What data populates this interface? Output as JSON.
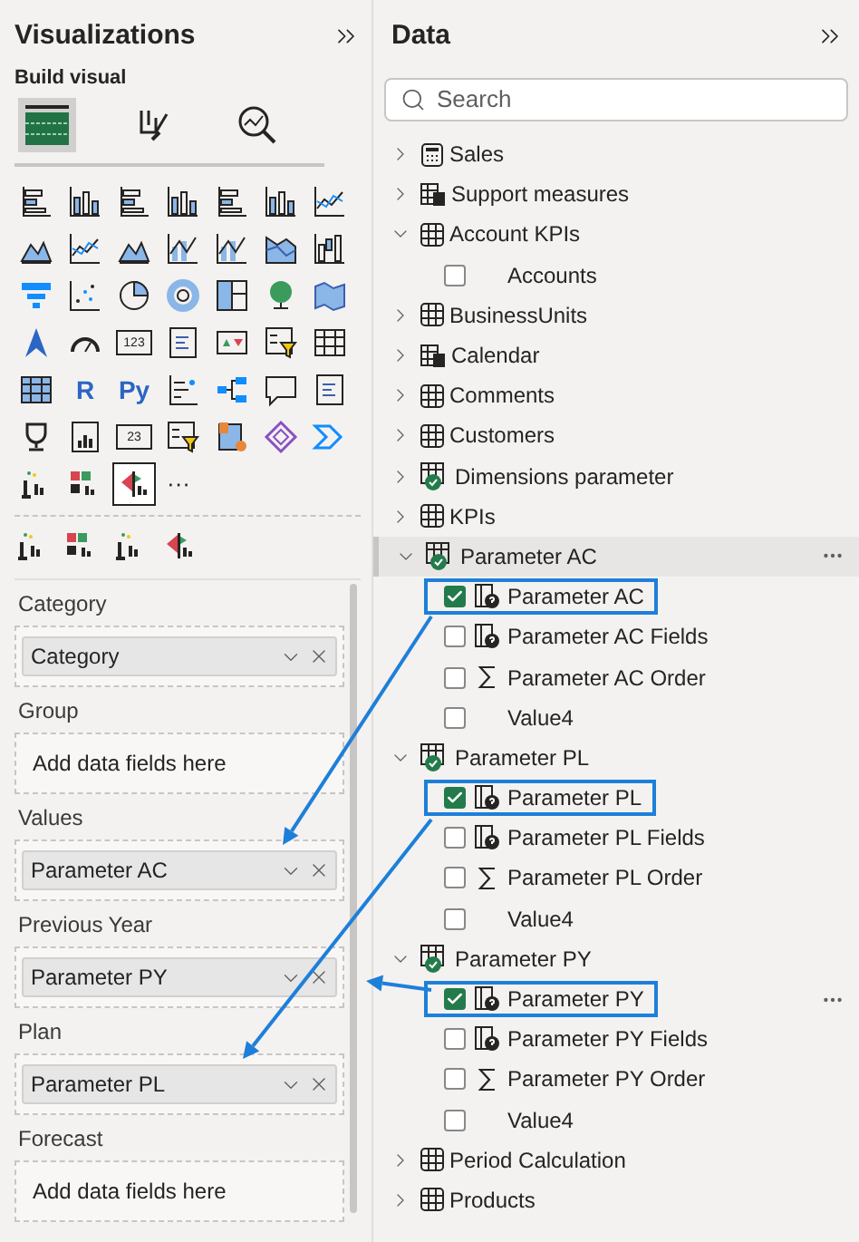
{
  "visualizations": {
    "title": "Visualizations",
    "subtitle": "Build visual",
    "build_tabs": [
      {
        "selected": true
      },
      {
        "selected": false
      },
      {
        "selected": false
      }
    ],
    "gallery": [
      {
        "selected": false
      },
      {
        "selected": false
      },
      {
        "selected": false
      },
      {
        "selected": false
      },
      {
        "selected": false
      },
      {
        "selected": false
      },
      {
        "selected": false
      },
      {
        "selected": false
      },
      {
        "selected": false
      },
      {
        "selected": false
      },
      {
        "selected": false
      },
      {
        "selected": false
      },
      {
        "selected": false
      },
      {
        "selected": false
      },
      {
        "selected": false
      },
      {
        "selected": false
      },
      {
        "selected": false
      },
      {
        "selected": false
      },
      {
        "selected": false
      },
      {
        "selected": false
      },
      {
        "selected": false
      },
      {
        "selected": false
      },
      {
        "selected": false
      },
      {
        "label": "123",
        "selected": false
      },
      {
        "selected": false
      },
      {
        "selected": false
      },
      {
        "selected": false
      },
      {
        "selected": false
      },
      {
        "selected": false
      },
      {
        "label": "R",
        "selected": false
      },
      {
        "label": "Py",
        "selected": false
      },
      {
        "selected": false
      },
      {
        "selected": false
      },
      {
        "selected": false
      },
      {
        "selected": false
      },
      {
        "selected": false
      },
      {
        "selected": false
      },
      {
        "label": "23",
        "selected": false
      },
      {
        "selected": false
      },
      {
        "selected": false
      },
      {
        "selected": false
      },
      {
        "selected": false
      },
      {
        "selected": false
      },
      {
        "selected": false
      },
      {
        "selected": true
      }
    ],
    "more_label": "···",
    "wells": [
      {
        "label": "Category",
        "value": "Category"
      },
      {
        "label": "Group",
        "placeholder": "Add data fields here"
      },
      {
        "label": "Values",
        "value": "Parameter AC"
      },
      {
        "label": "Previous Year",
        "value": "Parameter PY"
      },
      {
        "label": "Plan",
        "value": "Parameter PL"
      },
      {
        "label": "Forecast",
        "placeholder": "Add data fields here"
      }
    ]
  },
  "data": {
    "title": "Data",
    "search": {
      "placeholder": "Search"
    },
    "tables": [
      {
        "name": "Sales",
        "kind": "calculator",
        "expanded": false,
        "hovered": false
      },
      {
        "name": "Support measures",
        "kind": "measure-table",
        "expanded": false,
        "hovered": false
      },
      {
        "name": "Account KPIs",
        "kind": "table",
        "expanded": true,
        "hovered": false,
        "children": [
          {
            "name": "Accounts",
            "kind": "plain",
            "checked": false,
            "highlighted": false,
            "hovered": false
          }
        ]
      },
      {
        "name": "BusinessUnits",
        "kind": "table",
        "expanded": false,
        "hovered": false
      },
      {
        "name": "Calendar",
        "kind": "measure-table",
        "expanded": false,
        "hovered": false
      },
      {
        "name": "Comments",
        "kind": "table",
        "expanded": false,
        "hovered": false
      },
      {
        "name": "Customers",
        "kind": "table",
        "expanded": false,
        "hovered": false
      },
      {
        "name": "Dimensions parameter",
        "kind": "parameter-table",
        "expanded": false,
        "hovered": false
      },
      {
        "name": "KPIs",
        "kind": "table",
        "expanded": false,
        "hovered": false
      },
      {
        "name": "Parameter AC",
        "kind": "parameter-table",
        "expanded": true,
        "hovered": true,
        "children": [
          {
            "name": "Parameter AC",
            "kind": "parameter",
            "checked": true,
            "highlighted": true,
            "hovered": false
          },
          {
            "name": "Parameter AC Fields",
            "kind": "parameter",
            "checked": false,
            "highlighted": false,
            "hovered": false
          },
          {
            "name": "Parameter AC Order",
            "kind": "sum",
            "checked": false,
            "highlighted": false,
            "hovered": false
          },
          {
            "name": "Value4",
            "kind": "plain",
            "checked": false,
            "highlighted": false,
            "hovered": false
          }
        ]
      },
      {
        "name": "Parameter PL",
        "kind": "parameter-table",
        "expanded": true,
        "hovered": false,
        "children": [
          {
            "name": "Parameter PL",
            "kind": "parameter",
            "checked": true,
            "highlighted": true,
            "hovered": false
          },
          {
            "name": "Parameter PL Fields",
            "kind": "parameter",
            "checked": false,
            "highlighted": false,
            "hovered": false
          },
          {
            "name": "Parameter PL Order",
            "kind": "sum",
            "checked": false,
            "highlighted": false,
            "hovered": false
          },
          {
            "name": "Value4",
            "kind": "plain",
            "checked": false,
            "highlighted": false,
            "hovered": false
          }
        ]
      },
      {
        "name": "Parameter PY",
        "kind": "parameter-table",
        "expanded": true,
        "hovered": false,
        "children": [
          {
            "name": "Parameter PY",
            "kind": "parameter",
            "checked": true,
            "highlighted": true,
            "hovered": true
          },
          {
            "name": "Parameter PY Fields",
            "kind": "parameter",
            "checked": false,
            "highlighted": false,
            "hovered": false
          },
          {
            "name": "Parameter PY Order",
            "kind": "sum",
            "checked": false,
            "highlighted": false,
            "hovered": false
          },
          {
            "name": "Value4",
            "kind": "plain",
            "checked": false,
            "highlighted": false,
            "hovered": false
          }
        ]
      },
      {
        "name": "Period Calculation",
        "kind": "table",
        "expanded": false,
        "hovered": false
      },
      {
        "name": "Products",
        "kind": "table",
        "expanded": false,
        "hovered": false
      }
    ]
  }
}
